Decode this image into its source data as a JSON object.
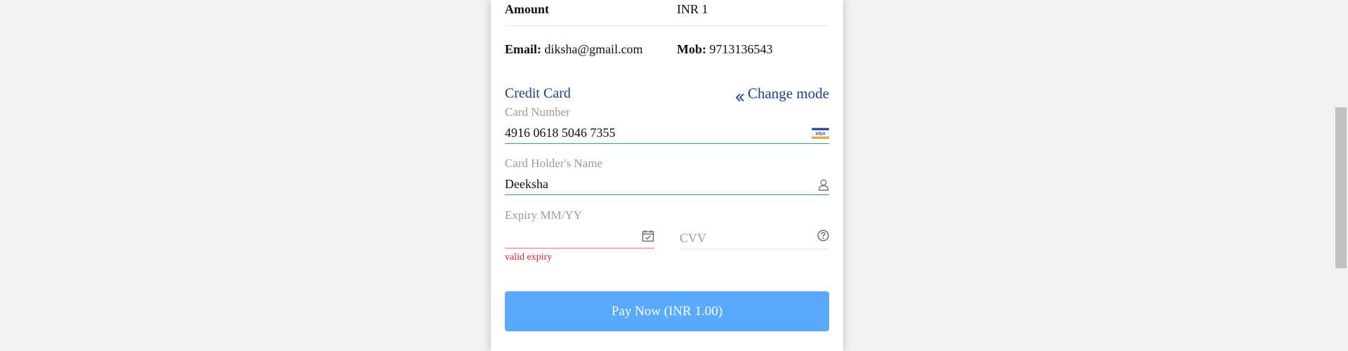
{
  "summary": {
    "amount_label": "Amount",
    "amount_value": "INR 1",
    "email_label": "Email:",
    "email_value": "diksha@gmail.com",
    "mobile_label": "Mob:",
    "mobile_value": "9713136543"
  },
  "payment": {
    "mode_title": "Credit Card",
    "change_mode_label": "Change mode",
    "card_number": {
      "label": "Card Number",
      "value": "4916 0618 5046 7355",
      "brand_icon": "visa-card-icon",
      "brand_text": "VISA"
    },
    "holder_name": {
      "label": "Card Holder's Name",
      "value": "Deeksha",
      "icon": "user-icon"
    },
    "expiry": {
      "label": "Expiry MM/YY",
      "value": "",
      "icon": "calendar-check-icon",
      "error": "valid expiry"
    },
    "cvv": {
      "placeholder": "CVV",
      "value": "",
      "icon": "help-circle-icon"
    },
    "pay_button_label": "Pay Now (INR 1.00)"
  },
  "colors": {
    "accent_blue": "#1d3d8f",
    "button_blue": "#59a9fc",
    "valid_green": "#3aa84a",
    "error_red": "#e8202a"
  }
}
